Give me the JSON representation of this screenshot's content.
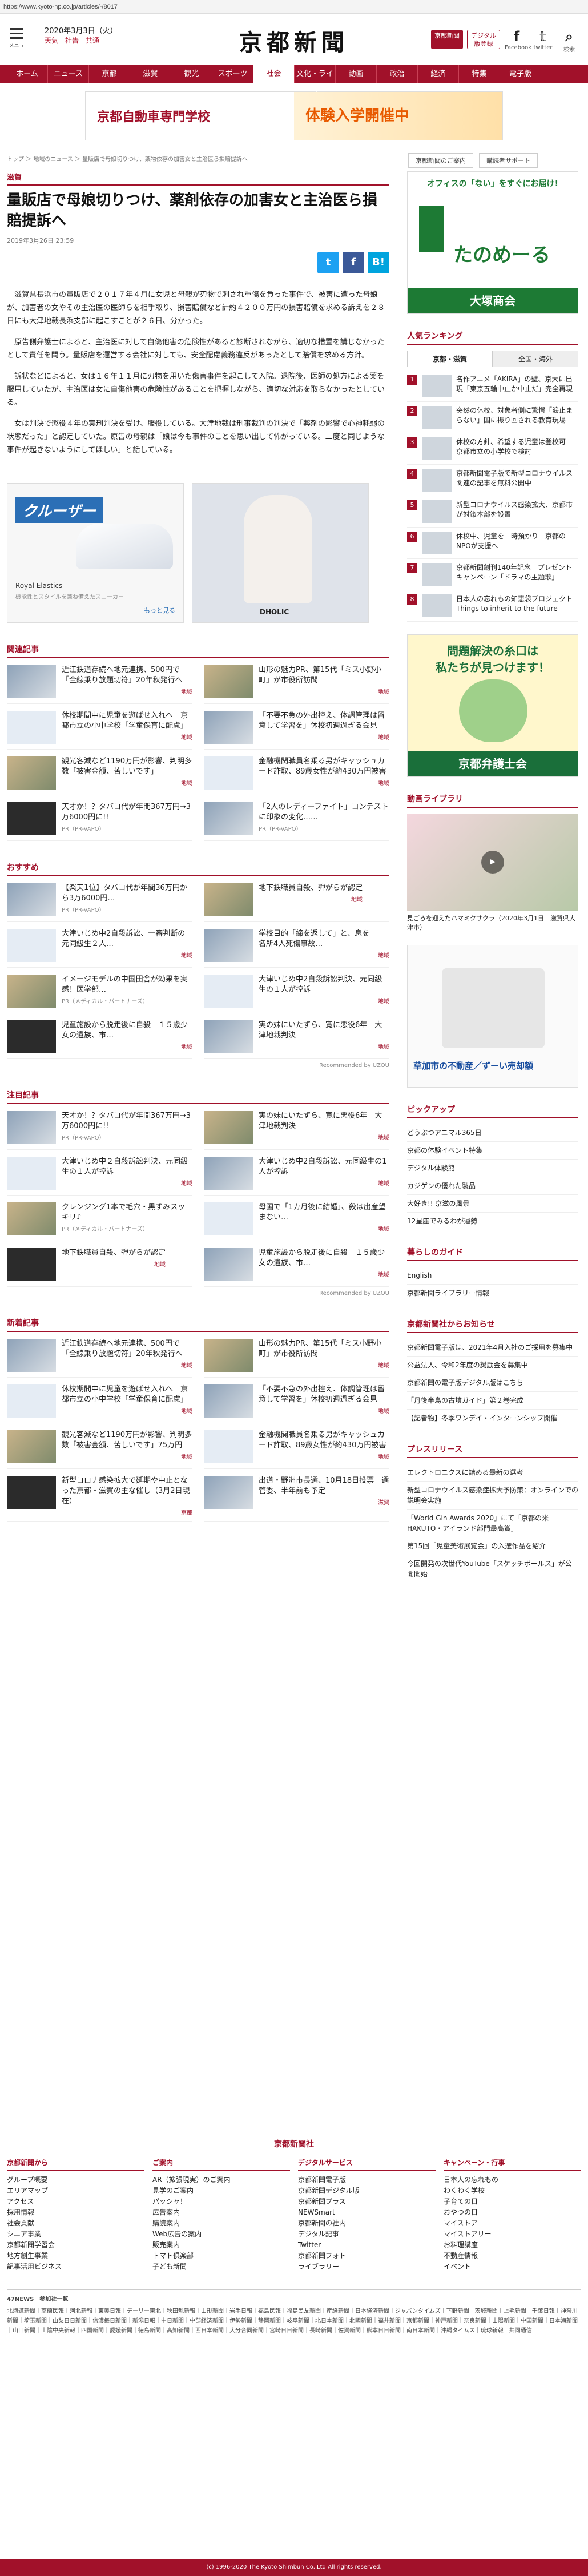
{
  "browser": {
    "url": "https://www.kyoto-np.co.jp/articles/-/8017"
  },
  "header": {
    "menu_label": "メニュー",
    "date": "2020年3月3日（火）",
    "weather": "天気　社告　共通",
    "logo": "京都新聞",
    "btn_news": "京都新聞",
    "btn_digital": "デジタル版登録",
    "facebook_label": "Facebook",
    "twitter_label": "twitter",
    "search_label": "検索"
  },
  "nav": {
    "items": [
      "ホーム",
      "ニュース",
      "京都",
      "滋賀",
      "観光",
      "スポーツ",
      "社会",
      "文化・ライフ",
      "動画",
      "政治",
      "経済",
      "特集",
      "電子版"
    ],
    "active_index": 6
  },
  "top_banner": {
    "left": "京都自動車専門学校",
    "right": "体験入学開催中"
  },
  "breadcrumb": "トップ ＞ 地域のニュース ＞ 量販店で母娘切りつけ、薬物依存の加害女と主治医ら損賠提訴へ",
  "side_links": [
    "京都新聞のご案内",
    "購読者サポート"
  ],
  "article": {
    "category": "滋賀",
    "title": "量販店で母娘切りつけ、薬剤依存の加害女と主治医ら損賠提訴へ",
    "posted": "2019年3月26日 23:59",
    "share": {
      "twitter": "t",
      "facebook": "f",
      "hatena": "B!"
    },
    "paragraphs": [
      "滋賀県長浜市の量販店で２０１７年４月に女児と母親が刃物で刺され重傷を負った事件で、被害に遭った母娘が、加害者の女やその主治医の医師らを相手取り、損害賠償など計約４２００万円の損害賠償を求める訴えを２８日にも大津地裁長浜支部に起こすことが２６日、分かった。",
      "原告側弁護士によると、主治医に対して自傷他害の危険性があると診断されながら、適切な措置を講じなかったとして責任を問う。量販店を運営する会社に対しても、安全配慮義務違反があったとして賠償を求める方針。",
      "訴状などによると、女は１６年１１月に刃物を用いた傷害事件を起こして入院。退院後、医師の処方による薬を服用していたが、主治医は女に自傷他害の危険性があることを把握しながら、適切な対応を取らなかったとしている。",
      "女は判決で懲役４年の実刑判決を受け、服役している。大津地裁は刑事裁判の判決で「薬剤の影響で心神耗弱の状態だった」と認定していた。原告の母親は「娘は今も事件のことを思い出して怖がっている。二度と同じような事件が起きないようにしてほしい」と話している。"
    ]
  },
  "ad_article": {
    "brand": "Royal Elastics",
    "headline": "クルーザー",
    "sub": "機能性とスタイルを兼ね備えたスニーカー",
    "cta": "もっと見る",
    "right_brand": "DHOLIC"
  },
  "related": {
    "title": "関連記事",
    "items": [
      {
        "text": "近江鉄道存続へ地元連携、500円で「全線乗り放題切符」20年秋発行へ",
        "tag": "地域"
      },
      {
        "text": "山形の魅力PR、第15代「ミス小野小町」が市役所訪問",
        "tag": "地域"
      },
      {
        "text": "休校期間中に児童を遊ばせ入れへ　京都市立の小中学校「学童保育に配慮」",
        "tag": "地域"
      },
      {
        "text": "「不要不急の外出控え、体調管理は留意して学習を」休校初週過ぎる会見",
        "tag": "地域"
      },
      {
        "text": "観光客減など1190万円が影響、判明多数「被害金額、苦しいです」",
        "tag": "地域"
      },
      {
        "text": "金融機関職員名乗る男がキャッシュカード詐取、89歳女性が約430万円被害",
        "tag": "地域"
      },
      {
        "text": "天才か！？タバコ代が年間367万円→3万6000円に!!",
        "tag": "PR（PR-VAPO）"
      },
      {
        "text": "「2人のレディーファイト」コンテストに印象の変化……",
        "tag": "PR（PR-VAPO）"
      }
    ]
  },
  "recommend": {
    "title": "おすすめ",
    "items": [
      {
        "text": "【楽天1位】タバコ代が年間36万円から3万6000円…",
        "tag": "PR（PR-VAPO）"
      },
      {
        "text": "地下鉄職員自殺、弾がらが認定",
        "tag": "地域"
      },
      {
        "text": "大津いじめ中2自殺訴訟、一審判断の元同級生２人…",
        "tag": "地域"
      },
      {
        "text": "学校目的「締を返して」と、息を　　名所4人死傷事故…",
        "tag": "地域"
      },
      {
        "text": "イメージモデルの中国田舎が効果を実感！医学部…",
        "tag": "PR（メディカル・パートナーズ）"
      },
      {
        "text": "大津いじめ中2自殺訴訟判決、元同級生の１人が控訴",
        "tag": "地域"
      },
      {
        "text": "児童施設から脱走後に自殺　１５歳少女の遺族、市…",
        "tag": "地域"
      },
      {
        "text": "実の妹にいたずら、寛に悪役6年　大津地裁判決",
        "tag": "地域"
      }
    ],
    "footer": "Recommended by UZOU"
  },
  "attention": {
    "title": "注目記事",
    "items": [
      {
        "text": "天才か！？タバコ代が年間367万円→3万6000円に!!",
        "tag": "PR（PR-VAPO）"
      },
      {
        "text": "実の妹にいたずら、寛に悪役6年　大津地裁判決",
        "tag": "地域"
      },
      {
        "text": "大津いじめ中２自殺訴訟判決、元同級生の１人が控訴",
        "tag": "地域"
      },
      {
        "text": "大津いじめ中2自殺訴訟、元同級生の1人が控訴",
        "tag": "地域"
      },
      {
        "text": "クレンジング1本で毛穴・黒ずみスッキリ♪",
        "tag": "PR（メディカル・パートナーズ）"
      },
      {
        "text": "母国で「1カ月後に結婚」、殺は出産望まない…",
        "tag": "地域"
      },
      {
        "text": "地下鉄職員自殺、弾がらが認定",
        "tag": "地域"
      },
      {
        "text": "児童施設から脱走後に自殺　１５歳少女の遺族、市…",
        "tag": "地域"
      }
    ],
    "footer": "Recommended by UZOU"
  },
  "latest": {
    "title": "新着記事",
    "items": [
      {
        "text": "近江鉄道存続へ地元連携、500円で「全線乗り放題切符」20年秋発行へ",
        "tag": "地域"
      },
      {
        "text": "山形の魅力PR、第15代「ミス小野小町」が市役所訪問",
        "tag": "地域"
      },
      {
        "text": "休校期間中に児童を遊ばせ入れへ　京都市立の小中学校「学童保育に配慮」",
        "tag": "地域"
      },
      {
        "text": "「不要不急の外出控え、体調管理は留意して学習を」休校初週過ぎる会見",
        "tag": "地域"
      },
      {
        "text": "観光客減など1190万円が影響、判明多数「被害金額、苦しいです」75万円",
        "tag": "地域"
      },
      {
        "text": "金融機関職員名乗る男がキャッシュカード詐取、89歳女性が約430万円被害",
        "tag": "地域"
      },
      {
        "text": "新型コロナ感染拡大で延期や中止となった京都・滋賀の主な催し（3月2日現在）",
        "tag": "京都"
      },
      {
        "text": "出道・野洲市長選、10月18日投票　選管委、半年前も予定",
        "tag": "滋賀"
      }
    ]
  },
  "sidebar": {
    "ad1": {
      "top": "オフィスの「ない」をすぐにお届け!",
      "brand": "たのめーる",
      "sub": "大塚商会"
    },
    "ranking_title": "人気ランキング",
    "ranking_tabs": [
      "京都・滋賀",
      "全国・海外"
    ],
    "ranking": [
      {
        "no": "1",
        "text": "名作アニメ「AKIRA」の壁、京大に出現「東京五輪中止か中止だ」完全再現"
      },
      {
        "no": "2",
        "text": "突然の休校、対象者側に驚愕「涙止まらない」国に振り回される教育現場"
      },
      {
        "no": "3",
        "text": "休校の方針、希望する児童は登校可　京都市立の小学校で検討"
      },
      {
        "no": "4",
        "text": "京都新聞電子版で新型コロナウイルス関連の記事を無料公開中"
      },
      {
        "no": "5",
        "text": "新型コロナウイルス感染拡大、京都市が対策本部を設置"
      },
      {
        "no": "6",
        "text": "休校中、児童を一時預かり　京都のNPOが支援へ"
      },
      {
        "no": "7",
        "text": "京都新聞創刊140年記念　プレゼントキャンペーン「ドラマの主題歌」"
      },
      {
        "no": "8",
        "text": "日本人の忘れもの知恵袋プロジェクト　Things to inherit to the future"
      }
    ],
    "ad2": {
      "top": "問題解決の糸口は",
      "mid": "私たちが見つけます！",
      "brand": "京都弁護士会"
    },
    "video_title": "動画ライブラリ",
    "video_caption": "見ごろを迎えたハマミクサクラ（2020年3月1日　滋賀県大津市）",
    "ad3": {
      "text": "草加市の不動産／ずーい売却額"
    },
    "pickup_title": "ピックアップ",
    "pickup": [
      "どうぶつアニマル365日",
      "京都の体験イベント特集",
      "デジタル体験館",
      "カジゲンの優れた製品",
      "大好き!! 京滋の風景",
      "12星座でみるわが運勢"
    ],
    "life_title": "暮らしのガイド",
    "life": [
      "English",
      "京都新聞ライブラリー情報"
    ],
    "press_title": "京都新聞社からお知らせ",
    "press": [
      "京都新聞電子版は、2021年4月入社のご採用を募集中",
      "公益法人、令和2年度の奨励金を募集中",
      "京都新聞の電子版デジタル版はこちら",
      "「丹後半島の古墳ガイド」第２巻完成",
      "【記者物】冬季ワンデイ・インターンシップ開催"
    ],
    "release_title": "プレスリリース",
    "release": [
      "エレクトロニクスに詰める最新の選考",
      "新型コロナウイルス感染症拡大予防策：オンラインでの説明会実施",
      "「World Gin Awards 2020」にて「京都の米 HAKUTO・アイランド部門最高賞」",
      "第15回「児童美術展覧会」の入選作品を紹介",
      "今回開発の次世代YouTube「スケッチボールス」が公開開始"
    ]
  },
  "footer": {
    "logo": "京都新聞社",
    "cols": [
      {
        "h": "京都新聞から",
        "items": [
          "グループ概要",
          "エリアマップ",
          "アクセス",
          "採用情報",
          "社会貢献",
          "シニア事業",
          "京都新聞学習会",
          "地方創生事業",
          "記事活用ビジネス"
        ]
      },
      {
        "h": "ご案内",
        "items": [
          "AR（拡張現実）のご案内",
          "見学のご案内",
          "パッシャ！",
          "広告案内",
          "購読案内",
          "Web広告の案内",
          "販売案内",
          "トマト倶楽部",
          "子ども新聞"
        ]
      },
      {
        "h": "デジタルサービス",
        "items": [
          "京都新聞電子版",
          "京都新聞デジタル版",
          "京都新聞プラス",
          "NEWSmart",
          "京都新聞の社内",
          "デジタル記事",
          "Twitter",
          "京都新聞フォト",
          "ライブラリー"
        ]
      },
      {
        "h": "キャンペーン・行事",
        "items": [
          "日本人の忘れもの",
          "わくわく学校",
          "子育ての日",
          "おやつの日",
          "マイストア",
          "マイストアリー",
          "お料理講座",
          "不動産情報",
          "イベント"
        ]
      }
    ],
    "links_title": "47NEWS　参加社一覧",
    "links": "北海道新聞｜室蘭民報｜河北新報｜東奥日報｜デーリー東北｜秋田魁新報｜山形新聞｜岩手日報｜福島民報｜福島民友新聞｜産経新聞｜日本経済新聞｜ジャパンタイムズ｜下野新聞｜茨城新聞｜上毛新聞｜千葉日報｜神奈川新聞｜埼玉新聞｜山梨日日新聞｜信濃毎日新聞｜新潟日報｜中日新聞｜中部経済新聞｜伊勢新聞｜静岡新聞｜岐阜新聞｜北日本新聞｜北國新聞｜福井新聞｜京都新聞｜神戸新聞｜奈良新聞｜山陽新聞｜中国新聞｜日本海新聞｜山口新聞｜山陰中央新報｜四国新聞｜愛媛新聞｜徳島新聞｜高知新聞｜西日本新聞｜大分合同新聞｜宮崎日日新聞｜長崎新聞｜佐賀新聞｜熊本日日新聞｜南日本新聞｜沖縄タイムス｜琉球新報｜共同通信",
    "copyright": "(c) 1996-2020 The Kyoto Shimbun Co.,Ltd All rights reserved."
  },
  "colors": {
    "brand": "#a1112a",
    "twitter": "#1da1f2",
    "facebook": "#3b5998",
    "hatena": "#00a4de"
  }
}
